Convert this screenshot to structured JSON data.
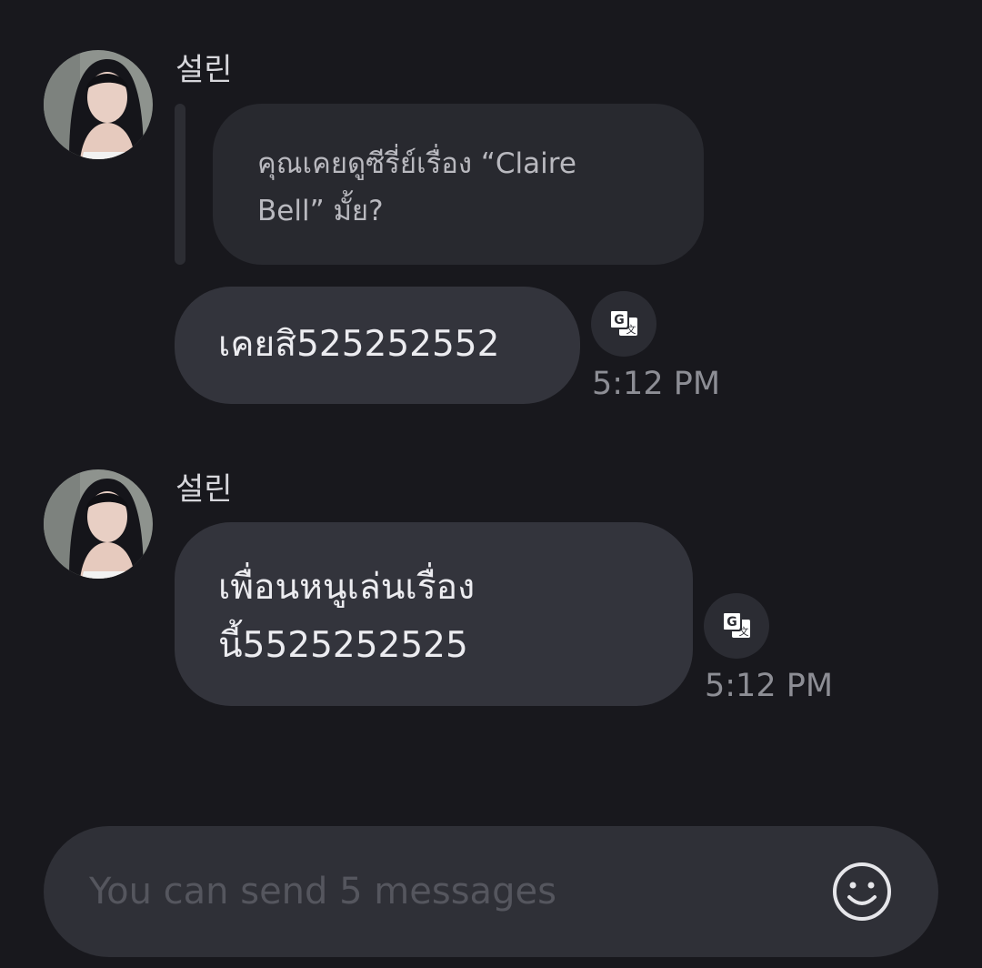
{
  "messages": [
    {
      "sender": "설린",
      "avatar": "profile-photo",
      "quoted": {
        "line1": "คุณเคยดูซีรี่ย์เรื่อง “Claire",
        "line2": "Bell” มั้ย?"
      },
      "text": "เคยสิ525252552",
      "time": "5:12 PM",
      "translate_icon": "translate-icon"
    },
    {
      "sender": "설린",
      "avatar": "profile-photo",
      "line1": "เพื่อนหนูเล่นเรื่อง",
      "line2": "นี้5525252525",
      "time": "5:12 PM",
      "translate_icon": "translate-icon"
    }
  ],
  "composer": {
    "placeholder": "You can send 5 messages",
    "value": "",
    "emoji_icon": "smiley-icon"
  },
  "colors": {
    "background": "#18181d",
    "bubble": "#33343c",
    "quoted_bubble": "#28292f",
    "composer": "#2f3037",
    "timestamp": "#8d8e95",
    "placeholder": "#55565e"
  }
}
